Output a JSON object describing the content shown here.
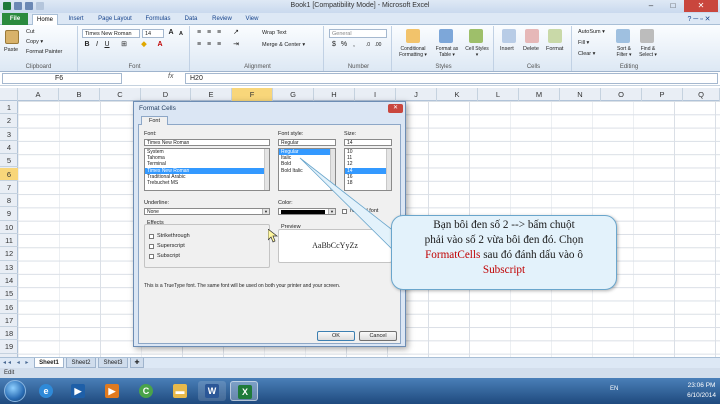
{
  "window": {
    "title": "Book1  [Compatibility Mode]  -  Microsoft Excel",
    "minimize": "–",
    "maximize": "□",
    "close": "✕"
  },
  "ribbon_tabs": [
    "File",
    "Home",
    "Insert",
    "Page Layout",
    "Formulas",
    "Data",
    "Review",
    "View"
  ],
  "ribbon": {
    "clipboard": {
      "label": "Clipboard",
      "paste": "Paste",
      "cut": "Cut",
      "copy": "Copy ▾",
      "format_painter": "Format Painter"
    },
    "font": {
      "label": "Font",
      "font_name": "Times New Roman",
      "font_size": "14"
    },
    "alignment": {
      "label": "Alignment",
      "wrap_text": "Wrap Text",
      "merge_center": "Merge & Center ▾"
    },
    "number": {
      "label": "Number",
      "format": "General"
    },
    "styles": {
      "label": "Styles",
      "conditional": "Conditional Formatting ▾",
      "format_table": "Format as Table ▾",
      "cell_styles": "Cell Styles ▾"
    },
    "cells": {
      "label": "Cells",
      "insert": "Insert",
      "delete": "Delete",
      "format": "Format"
    },
    "editing": {
      "label": "Editing",
      "autosum": "AutoSum ▾",
      "fill": "Fill ▾",
      "clear": "Clear ▾",
      "sort_filter": "Sort & Filter ▾",
      "find_select": "Find & Select ▾"
    }
  },
  "formula_bar": {
    "name_box": "F6",
    "fx": "fx",
    "content": "H20"
  },
  "columns": [
    "A",
    "B",
    "C",
    "D",
    "E",
    "F",
    "G",
    "H",
    "I",
    "J",
    "K",
    "L",
    "M",
    "N",
    "O",
    "P",
    "Q"
  ],
  "rows": [
    "1",
    "2",
    "3",
    "4",
    "5",
    "6",
    "7",
    "8",
    "9",
    "10",
    "11",
    "12",
    "13",
    "14",
    "15",
    "16",
    "17",
    "18",
    "19"
  ],
  "selected_cell": {
    "column": "F",
    "row": "6"
  },
  "sheets": [
    "Sheet1",
    "Sheet2",
    "Sheet3"
  ],
  "status": "Edit",
  "dialog": {
    "title": "Format Cells",
    "tab": "Font",
    "font_label": "Font:",
    "font_value": "Times New Roman",
    "font_list": [
      "System",
      "Tahoma",
      "Terminal",
      "Times New Roman",
      "Traditional Arabic",
      "Trebuchet MS"
    ],
    "font_selected": "Times New Roman",
    "style_label": "Font style:",
    "style_value": "Regular",
    "style_list": [
      "Regular",
      "Italic",
      "Bold",
      "Bold Italic"
    ],
    "style_selected": "Regular",
    "size_label": "Size:",
    "size_value": "14",
    "size_list": [
      "10",
      "11",
      "12",
      "14",
      "16",
      "18"
    ],
    "size_selected": "14",
    "underline_label": "Underline:",
    "underline_value": "None",
    "color_label": "Color:",
    "normal_font": "Normal font",
    "effects_label": "Effects",
    "effects": [
      "Strikethrough",
      "Superscript",
      "Subscript"
    ],
    "preview_label": "Preview",
    "preview_text": "AaBbCcYyZz",
    "note": "This is a TrueType font.  The same font will be used on both your printer and your screen.",
    "ok": "OK",
    "cancel": "Cancel"
  },
  "callout": {
    "line1": "Bạn bôi đen số 2 --> bấm chuột",
    "line2": "phải vào số 2 vừa bôi đen đó. Chọn",
    "highlight1": "FormatCells",
    "line3_rest": " sau đó đánh dấu vào ô",
    "highlight2": "Subscript"
  },
  "taskbar": {
    "language": "EN",
    "time": "23:06 PM",
    "date": "6/10/2014"
  },
  "colors": {
    "file_tab": "#2a8a3e",
    "selection": "#f8d67a",
    "callout_accent": "#c00000",
    "close": "#c9463d"
  }
}
